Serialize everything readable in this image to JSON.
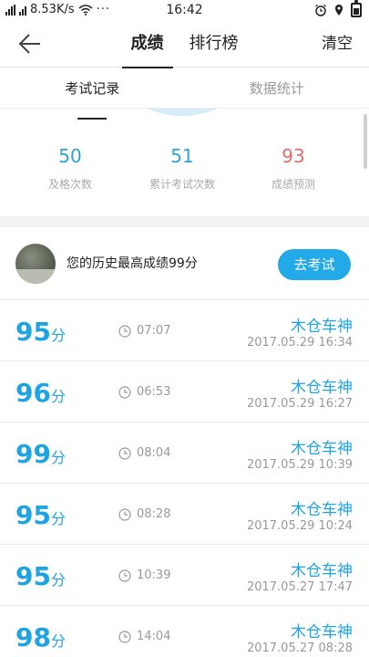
{
  "status_bar": {
    "network_speed": "8.53K/s",
    "time": "16:42"
  },
  "top_nav": {
    "tabs": [
      {
        "label": "成绩",
        "active": true
      },
      {
        "label": "排行榜",
        "active": false
      }
    ],
    "clear_label": "清空"
  },
  "sub_tabs": [
    {
      "label": "考试记录",
      "active": true
    },
    {
      "label": "数据统计",
      "active": false
    }
  ],
  "stats": [
    {
      "value": "50",
      "label": "及格次数",
      "color": "#2aa3d8"
    },
    {
      "value": "51",
      "label": "累计考试次数",
      "color": "#2aa3d8"
    },
    {
      "value": "93",
      "label": "成绩预测",
      "color": "#e06b6b"
    }
  ],
  "best": {
    "text": "您的历史最高成绩99分",
    "button_label": "去考试"
  },
  "records": [
    {
      "score": "95",
      "unit": "分",
      "duration": "07:07",
      "name": "木仓车神",
      "date": "2017.05.29  16:34"
    },
    {
      "score": "96",
      "unit": "分",
      "duration": "06:53",
      "name": "木仓车神",
      "date": "2017.05.29  16:27"
    },
    {
      "score": "99",
      "unit": "分",
      "duration": "08:04",
      "name": "木仓车神",
      "date": "2017.05.29  10:39"
    },
    {
      "score": "95",
      "unit": "分",
      "duration": "08:28",
      "name": "木仓车神",
      "date": "2017.05.29  10:24"
    },
    {
      "score": "95",
      "unit": "分",
      "duration": "10:39",
      "name": "木仓车神",
      "date": "2017.05.27  17:47"
    },
    {
      "score": "98",
      "unit": "分",
      "duration": "14:04",
      "name": "木仓车神",
      "date": "2017.05.27  08:28"
    }
  ]
}
